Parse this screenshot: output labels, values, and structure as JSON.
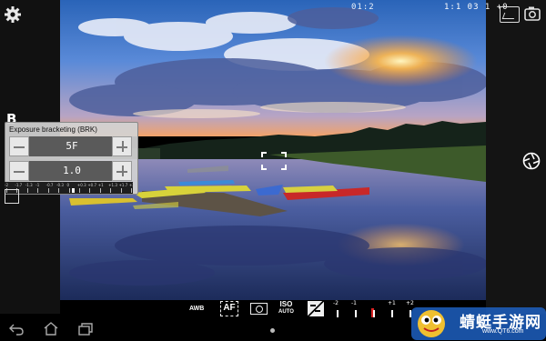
{
  "status": {
    "shots_counter": "01:2",
    "right_info": "1:1 03 1 +0"
  },
  "mode": {
    "letter": "B"
  },
  "bracketing": {
    "title": "Exposure bracketing (BRK)",
    "frames_value": "5F",
    "step_value": "1.0",
    "scale_labels": [
      "-2",
      "-1.7",
      "-1.3",
      "-1",
      "-0.7",
      "-0.3",
      "0",
      "+0.3",
      "+0.7",
      "+1",
      "+1.3",
      "+1.7",
      "+2"
    ]
  },
  "toolbar": {
    "awb": "AWB",
    "af": "AF",
    "iso_top": "ISO",
    "iso_bottom": "AUTO",
    "ev_labels": [
      "-2",
      "-1",
      "0",
      "+1",
      "+2"
    ]
  },
  "icons": {
    "settings": "gear-icon",
    "gallery": "gallery-icon",
    "camera_settings": "camera-settings-icon",
    "shutter": "shutter-icon"
  },
  "watermark": {
    "text": "蜻蜓手游网",
    "url": "www.QT6.com"
  }
}
